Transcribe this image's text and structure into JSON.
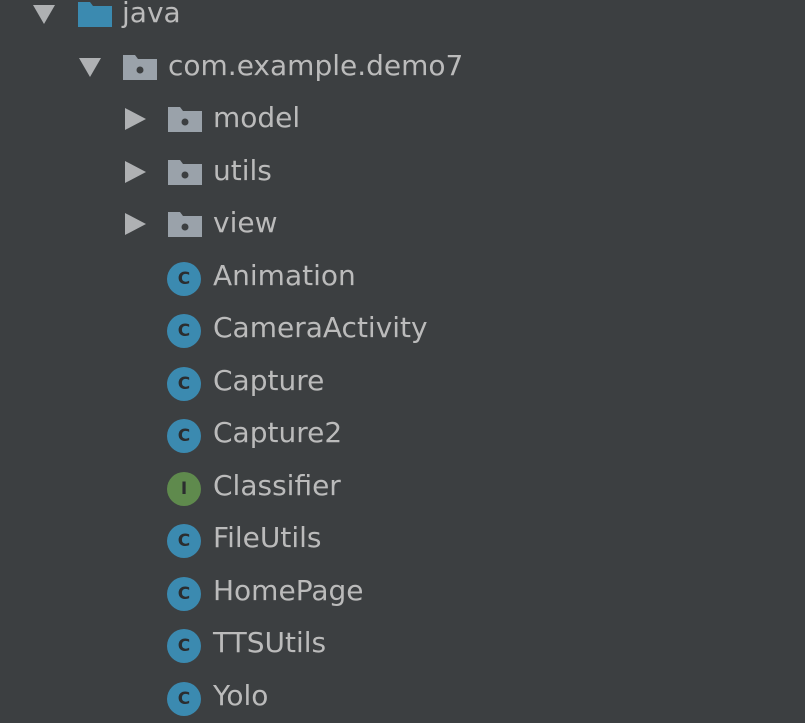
{
  "tree": {
    "items": [
      {
        "label": "java",
        "kind": "source-folder",
        "expanded": true,
        "depth": 0
      },
      {
        "label": "com.example.demo7",
        "kind": "package",
        "expanded": true,
        "depth": 1
      },
      {
        "label": "model",
        "kind": "package",
        "expanded": false,
        "depth": 2
      },
      {
        "label": "utils",
        "kind": "package",
        "expanded": false,
        "depth": 2
      },
      {
        "label": "view",
        "kind": "package",
        "expanded": false,
        "depth": 2
      },
      {
        "label": "Animation",
        "kind": "class",
        "badge": "C",
        "depth": 2
      },
      {
        "label": "CameraActivity",
        "kind": "class",
        "badge": "C",
        "depth": 2
      },
      {
        "label": "Capture",
        "kind": "class",
        "badge": "C",
        "depth": 2
      },
      {
        "label": "Capture2",
        "kind": "class",
        "badge": "C",
        "depth": 2
      },
      {
        "label": "Classifier",
        "kind": "interface",
        "badge": "I",
        "depth": 2
      },
      {
        "label": "FileUtils",
        "kind": "class",
        "badge": "C",
        "depth": 2
      },
      {
        "label": "HomePage",
        "kind": "class",
        "badge": "C",
        "depth": 2
      },
      {
        "label": "TTSUtils",
        "kind": "class",
        "badge": "C",
        "depth": 2
      },
      {
        "label": "Yolo",
        "kind": "class",
        "badge": "C",
        "depth": 2
      }
    ]
  },
  "colors": {
    "background": "#3c3f41",
    "text": "#bbbbbb",
    "source_folder": "#3b8ab0",
    "package_folder": "#9aa2aa",
    "class_badge": "#3b8ab0",
    "interface_badge": "#5f8a4d"
  }
}
